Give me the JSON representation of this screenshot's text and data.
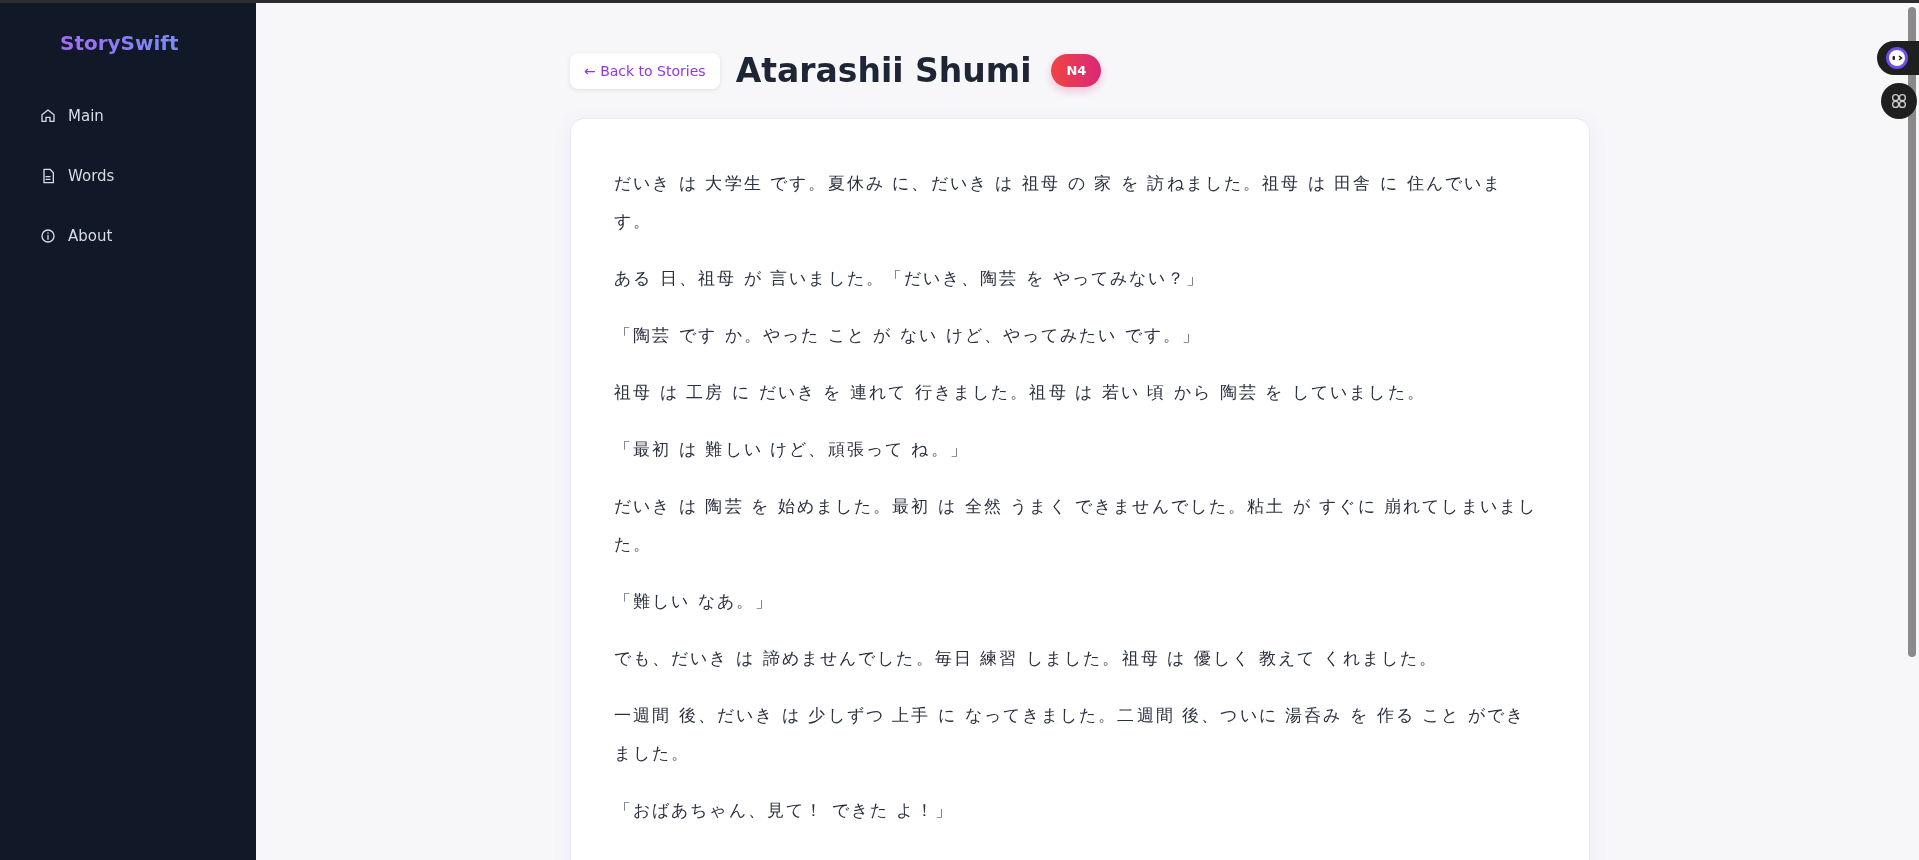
{
  "sidebar": {
    "logo": "StorySwift",
    "items": [
      {
        "label": "Main",
        "selected": false
      },
      {
        "label": "Words",
        "selected": false
      },
      {
        "label": "About",
        "selected": false
      }
    ]
  },
  "header": {
    "back_button": "← Back to Stories",
    "title": "Atarashii Shumi",
    "level_badge": "N4"
  },
  "story": {
    "paragraphs": [
      "だいき は 大学生 です。夏休み に、だいき は 祖母 の 家 を 訪ねました。祖母 は 田舎 に 住んでいます。",
      "ある 日、祖母 が 言いました。「だいき、陶芸 を やってみない？」",
      "「陶芸 です か。やった こと が ない けど、やってみたい です。」",
      "祖母 は 工房 に だいき を 連れて 行きました。祖母 は 若い 頃 から 陶芸 を していました。",
      "「最初 は 難しい けど、頑張って ね。」",
      "だいき は 陶芸 を 始めました。最初 は 全然 うまく できませんでした。粘土 が すぐに 崩れてしまいました。",
      "「難しい なあ。」",
      "でも、だいき は 諦めませんでした。毎日 練習 しました。祖母 は 優しく 教えて くれました。",
      "一週間 後、だいき は 少しずつ 上手 に なってきました。二週間 後、ついに 湯呑み を 作る こと ができました。",
      "「おばあちゃん、見て！ できた よ！」"
    ]
  }
}
